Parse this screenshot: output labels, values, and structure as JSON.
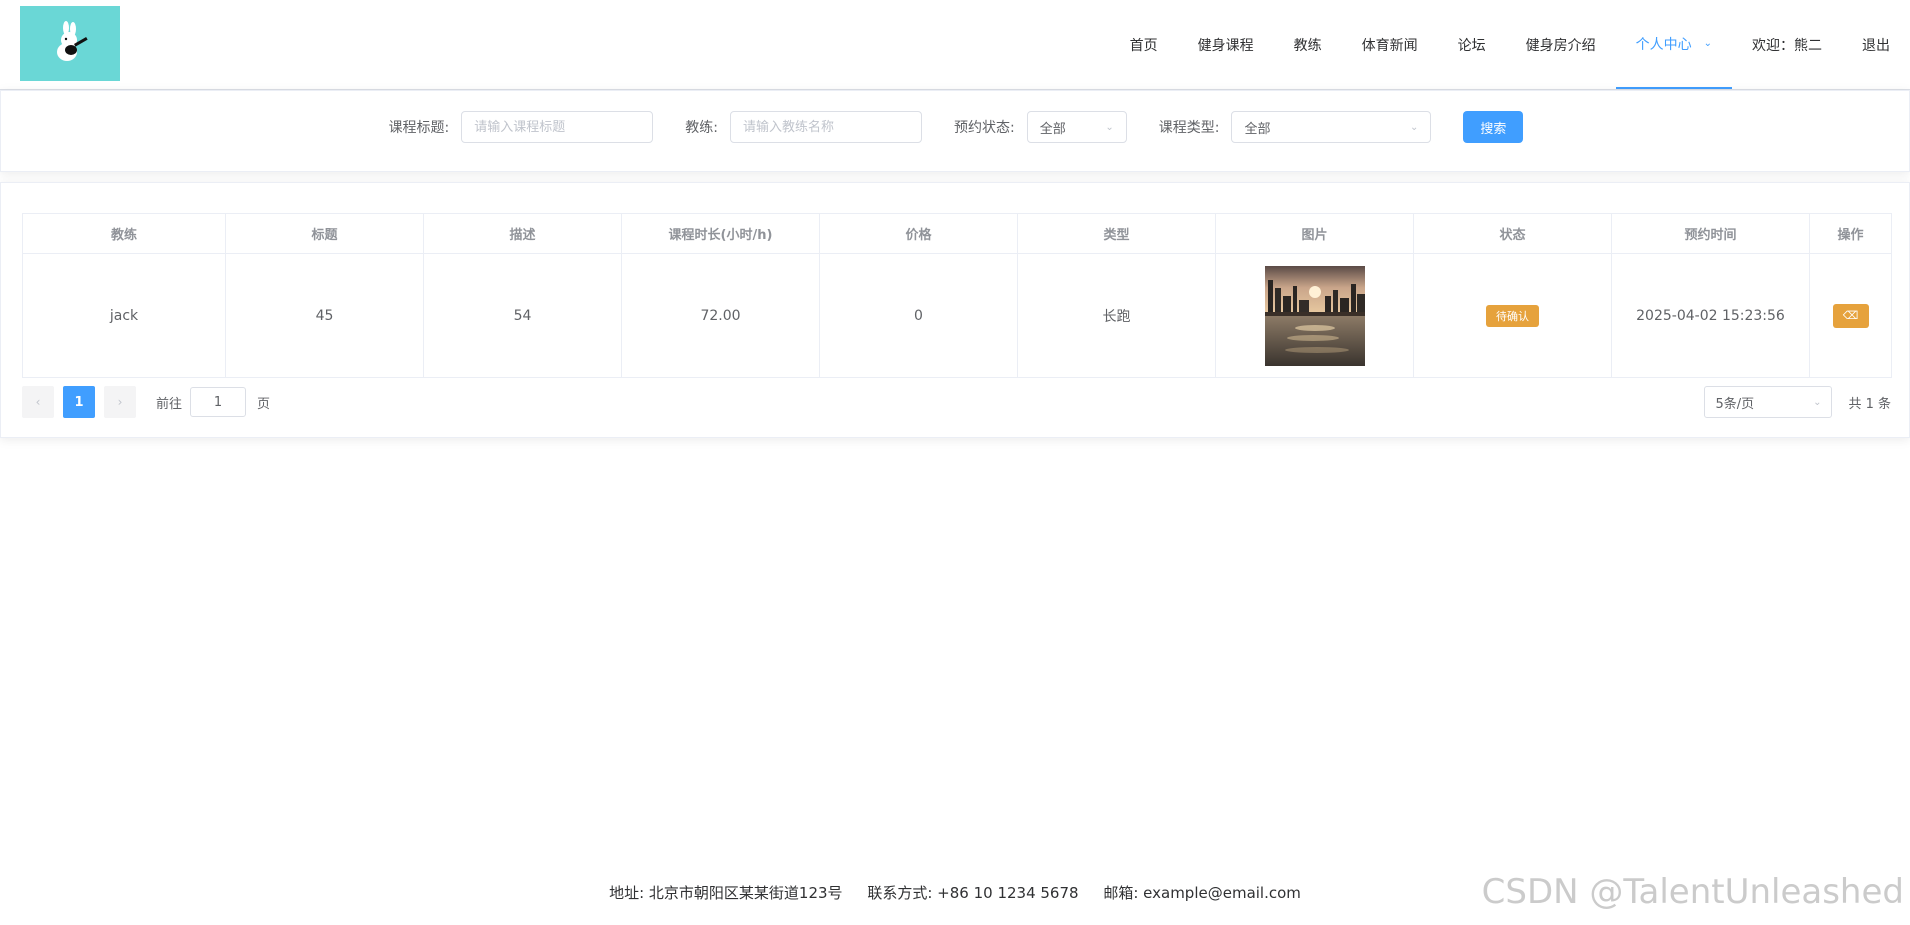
{
  "header": {
    "nav": [
      "首页",
      "健身课程",
      "教练",
      "体育新闻",
      "论坛",
      "健身房介绍",
      "个人中心",
      "欢迎：熊二",
      "退出"
    ],
    "active_index": 6
  },
  "search": {
    "title_label": "课程标题:",
    "title_placeholder": "请输入课程标题",
    "coach_label": "教练:",
    "coach_placeholder": "请输入教练名称",
    "status_label": "预约状态:",
    "status_value": "全部",
    "type_label": "课程类型:",
    "type_value": "全部",
    "search_button": "搜索"
  },
  "table": {
    "columns": [
      "教练",
      "标题",
      "描述",
      "课程时长(小时/h)",
      "价格",
      "类型",
      "图片",
      "状态",
      "预约时间",
      "操作"
    ],
    "rows": [
      {
        "coach": "jack",
        "title": "45",
        "desc": "54",
        "duration": "72.00",
        "price": "0",
        "type": "长跑",
        "status": "待确认",
        "time": "2025-04-02 15:23:56"
      }
    ]
  },
  "pagination": {
    "current_page": "1",
    "goto_label": "前往",
    "goto_value": "1",
    "page_suffix": "页",
    "page_size": "5条/页",
    "total": "共 1 条"
  },
  "footer": {
    "address": "地址: 北京市朝阳区某某街道123号",
    "contact": "联系方式: +86 10 1234 5678",
    "email": "邮箱: example@email.com"
  },
  "watermark": "CSDN @TalentUnleashed",
  "colors": {
    "primary": "#409eff",
    "warning": "#e6a23c",
    "logo_bg": "#6ad7d6"
  }
}
